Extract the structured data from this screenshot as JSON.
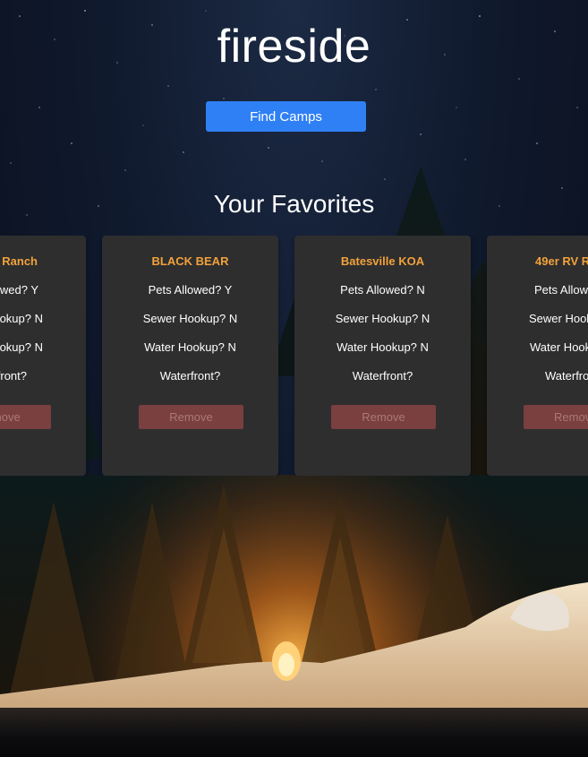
{
  "app": {
    "title": "fireside"
  },
  "header": {
    "find_button_label": "Find Camps"
  },
  "favorites": {
    "heading": "Your Favorites",
    "cards": [
      {
        "name": "Ranch",
        "pets": "Pets Allowed? Y",
        "sewer": "Sewer Hookup? N",
        "water": "Water Hookup? N",
        "waterfront": "Waterfront?",
        "remove_label": "Remove"
      },
      {
        "name": "BLACK BEAR",
        "pets": "Pets Allowed? Y",
        "sewer": "Sewer Hookup? N",
        "water": "Water Hookup? N",
        "waterfront": "Waterfront?",
        "remove_label": "Remove"
      },
      {
        "name": "Batesville KOA",
        "pets": "Pets Allowed? N",
        "sewer": "Sewer Hookup? N",
        "water": "Water Hookup? N",
        "waterfront": "Waterfront?",
        "remove_label": "Remove"
      },
      {
        "name": "49er RV R",
        "pets": "Pets Allowe",
        "sewer": "Sewer Hook",
        "water": "Water Hook",
        "waterfront": "Waterfro",
        "remove_label": "Remov"
      }
    ]
  },
  "colors": {
    "accent_button": "#2f80f5",
    "card_background": "#2e2e2f",
    "card_title": "#f2a23a",
    "remove_button": "#7a3f3f"
  }
}
